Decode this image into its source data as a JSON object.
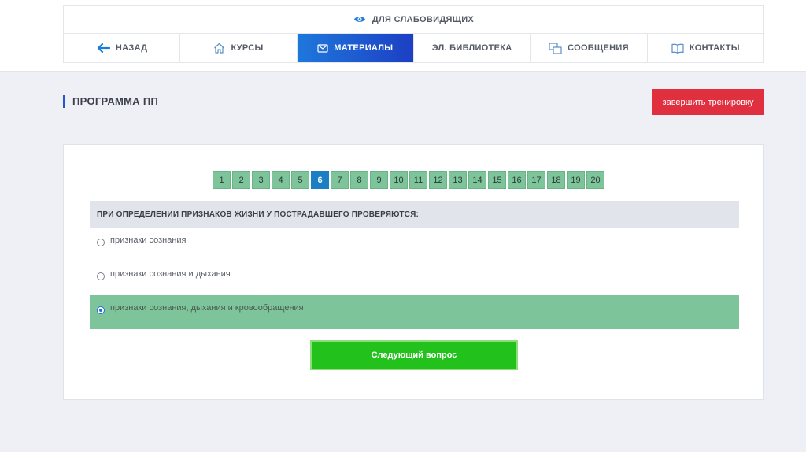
{
  "accessibility": {
    "label": "ДЛЯ СЛАБОВИДЯЩИХ",
    "icon": "eye-icon"
  },
  "nav": {
    "back": "НАЗАД",
    "courses": "КУРСЫ",
    "materials": "МАТЕРИАЛЫ",
    "library": "ЭЛ. БИБЛИОТЕКА",
    "messages": "СООБЩЕНИЯ",
    "contacts": "КОНТАКТЫ",
    "active": "materials"
  },
  "page": {
    "title": "ПРОГРАММА ПП",
    "finish_label": "завершить тренировку"
  },
  "pager": {
    "pages": [
      "1",
      "2",
      "3",
      "4",
      "5",
      "6",
      "7",
      "8",
      "9",
      "10",
      "11",
      "12",
      "13",
      "14",
      "15",
      "16",
      "17",
      "18",
      "19",
      "20"
    ],
    "current": "6"
  },
  "quiz": {
    "question": "ПРИ ОПРЕДЕЛЕНИИ ПРИЗНАКОВ ЖИЗНИ У ПОСТРАДАВШЕГО ПРОВЕРЯЮТСЯ:",
    "answers": [
      {
        "text": "признаки сознания",
        "selected": false
      },
      {
        "text": "признаки сознания и дыхания",
        "selected": false
      },
      {
        "text": "признаки сознания, дыхания и кровообращения",
        "selected": true
      }
    ],
    "next_label": "Следующий вопрос"
  },
  "colors": {
    "accent": "#1d3fc4",
    "finish": "#e03040",
    "page_cell": "#7ec49a",
    "page_current": "#1b7fc4",
    "next": "#22c11b"
  }
}
